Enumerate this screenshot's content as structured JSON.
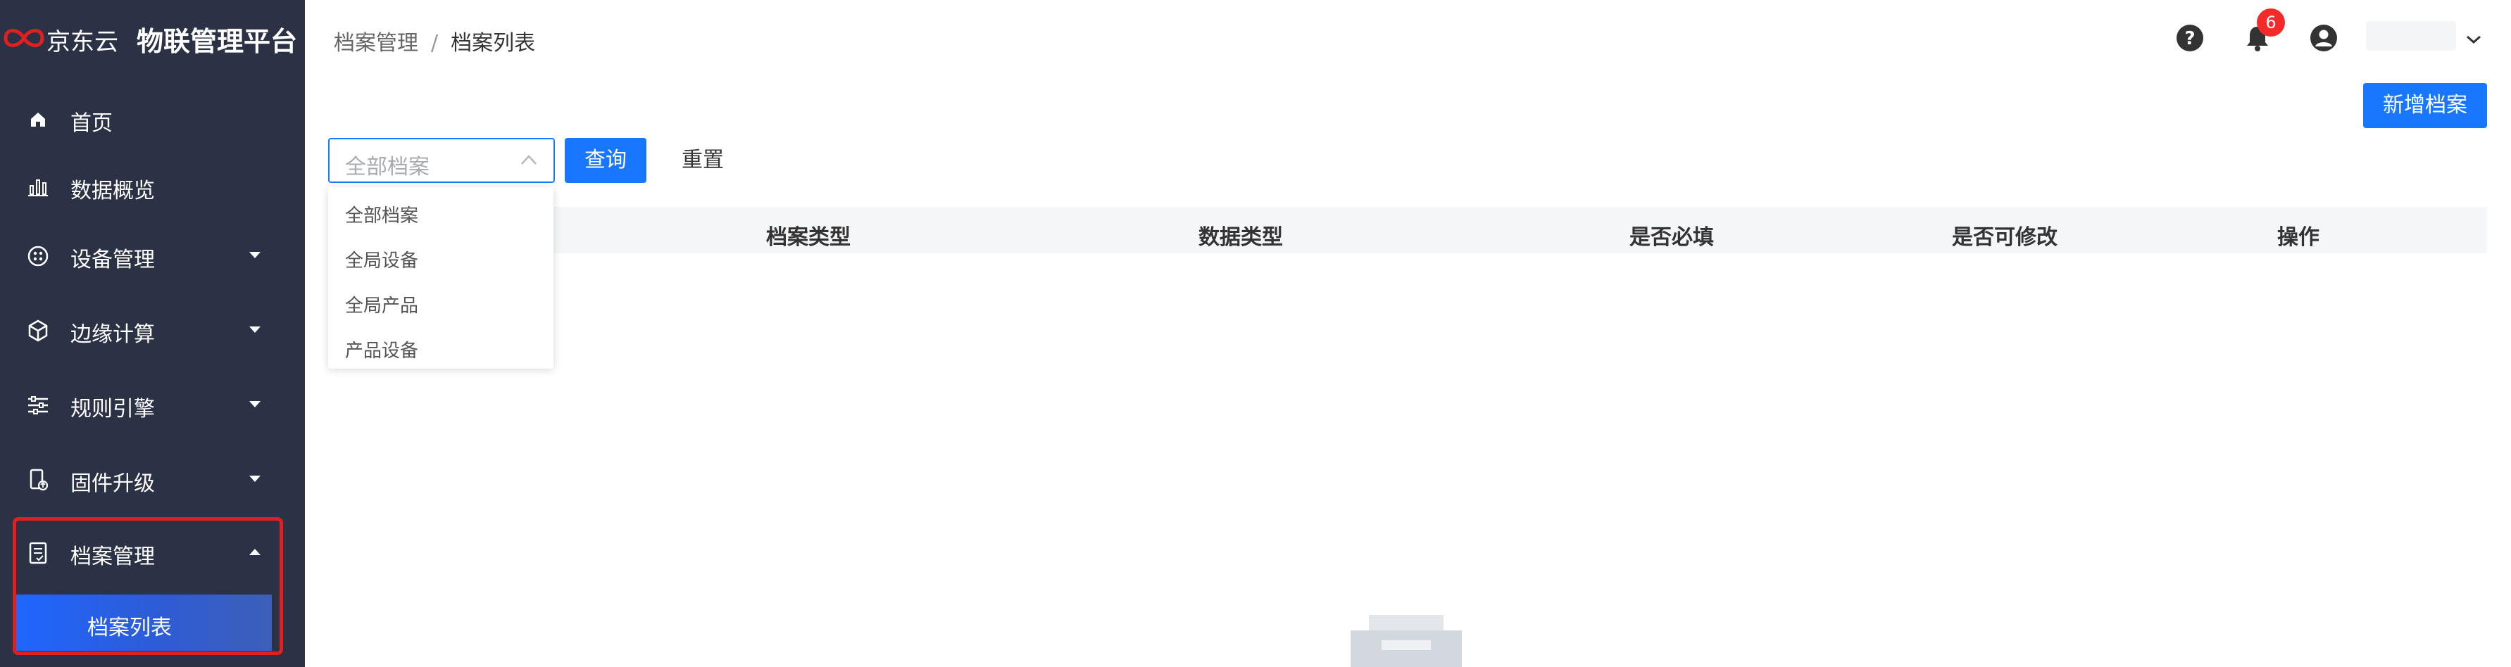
{
  "brand": {
    "logo_text": "京东云",
    "app_title": "物联管理平台",
    "accent_color": "#e02020"
  },
  "sidebar": {
    "background": "#2b3245",
    "items": [
      {
        "label": "首页",
        "icon": "home-icon",
        "has_caret": false
      },
      {
        "label": "数据概览",
        "icon": "bar-chart-icon",
        "has_caret": false
      },
      {
        "label": "设备管理",
        "icon": "device-grid-icon",
        "has_caret": true
      },
      {
        "label": "边缘计算",
        "icon": "cube-icon",
        "has_caret": true
      },
      {
        "label": "规则引擎",
        "icon": "sliders-icon",
        "has_caret": true
      },
      {
        "label": "固件升级",
        "icon": "firmware-icon",
        "has_caret": true
      },
      {
        "label": "档案管理",
        "icon": "document-icon",
        "has_caret": true,
        "expanded": true
      }
    ],
    "active_subitem": "档案列表"
  },
  "breadcrumb": {
    "parent": "档案管理",
    "separator": "/",
    "current": "档案列表"
  },
  "header": {
    "help_icon": "help-icon",
    "notification_icon": "bell-icon",
    "notification_count": "6",
    "user_icon": "user-icon"
  },
  "toolbar": {
    "new_button": "新增档案",
    "query_button": "查询",
    "reset_button": "重置",
    "primary_color": "#1876ff"
  },
  "filter": {
    "placeholder": "全部档案",
    "expanded": true,
    "options": [
      "全部档案",
      "全局设备",
      "全局产品",
      "产品设备"
    ]
  },
  "table": {
    "columns": [
      "档案类型",
      "数据类型",
      "是否必填",
      "是否可修改",
      "操作"
    ],
    "rows": []
  }
}
